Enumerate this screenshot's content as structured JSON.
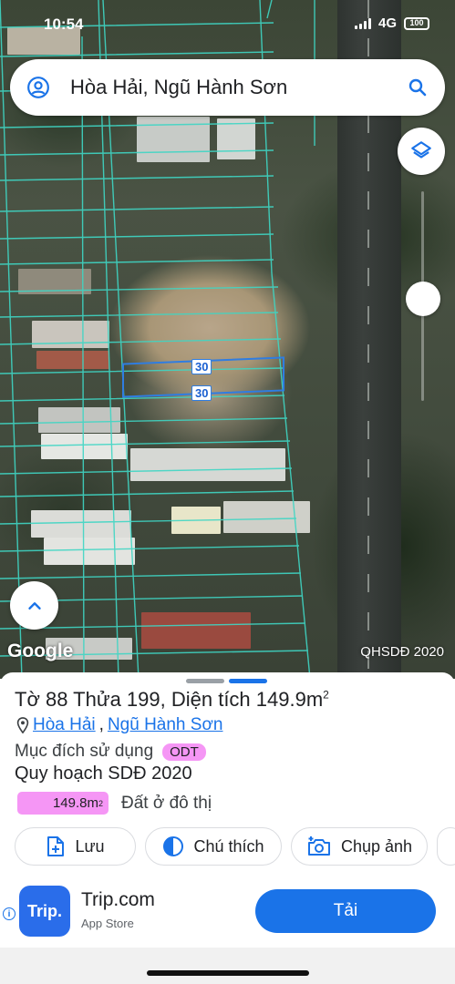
{
  "status": {
    "time": "10:54",
    "network": "4G",
    "battery": "100"
  },
  "search": {
    "query": "Hòa Hải, Ngũ Hành Sơn"
  },
  "map": {
    "measure_top": "30",
    "measure_bottom": "30",
    "attribution": "Google",
    "layer_label": "QHSDĐ 2020"
  },
  "parcel": {
    "title_prefix": "Tờ 88 Thửa 199, Diện tích 149.9m",
    "title_sup": "2",
    "ward": "Hòa Hải",
    "district": "Ngũ Hành Sơn",
    "separator": ",",
    "purpose_label": "Mục đích sử dụng",
    "purpose_code": "ODT",
    "plan_title": "Quy hoạch SDĐ 2020",
    "plan_area": "149.8m",
    "plan_area_sup": "2",
    "plan_land_type": "Đất ở đô thị"
  },
  "actions": [
    {
      "label": "Lưu",
      "icon": "add-document-icon"
    },
    {
      "label": "Chú thích",
      "icon": "half-circle-icon"
    },
    {
      "label": "Chụp ảnh",
      "icon": "camera-add-icon"
    }
  ],
  "ad": {
    "icon_text": "Trip.",
    "title": "Trip.com",
    "subtitle": "App Store",
    "button": "Tải"
  },
  "colors": {
    "accent": "#1a73e8",
    "parcel_line": "#3fd6c4",
    "badge_pink": "#f596f5"
  }
}
